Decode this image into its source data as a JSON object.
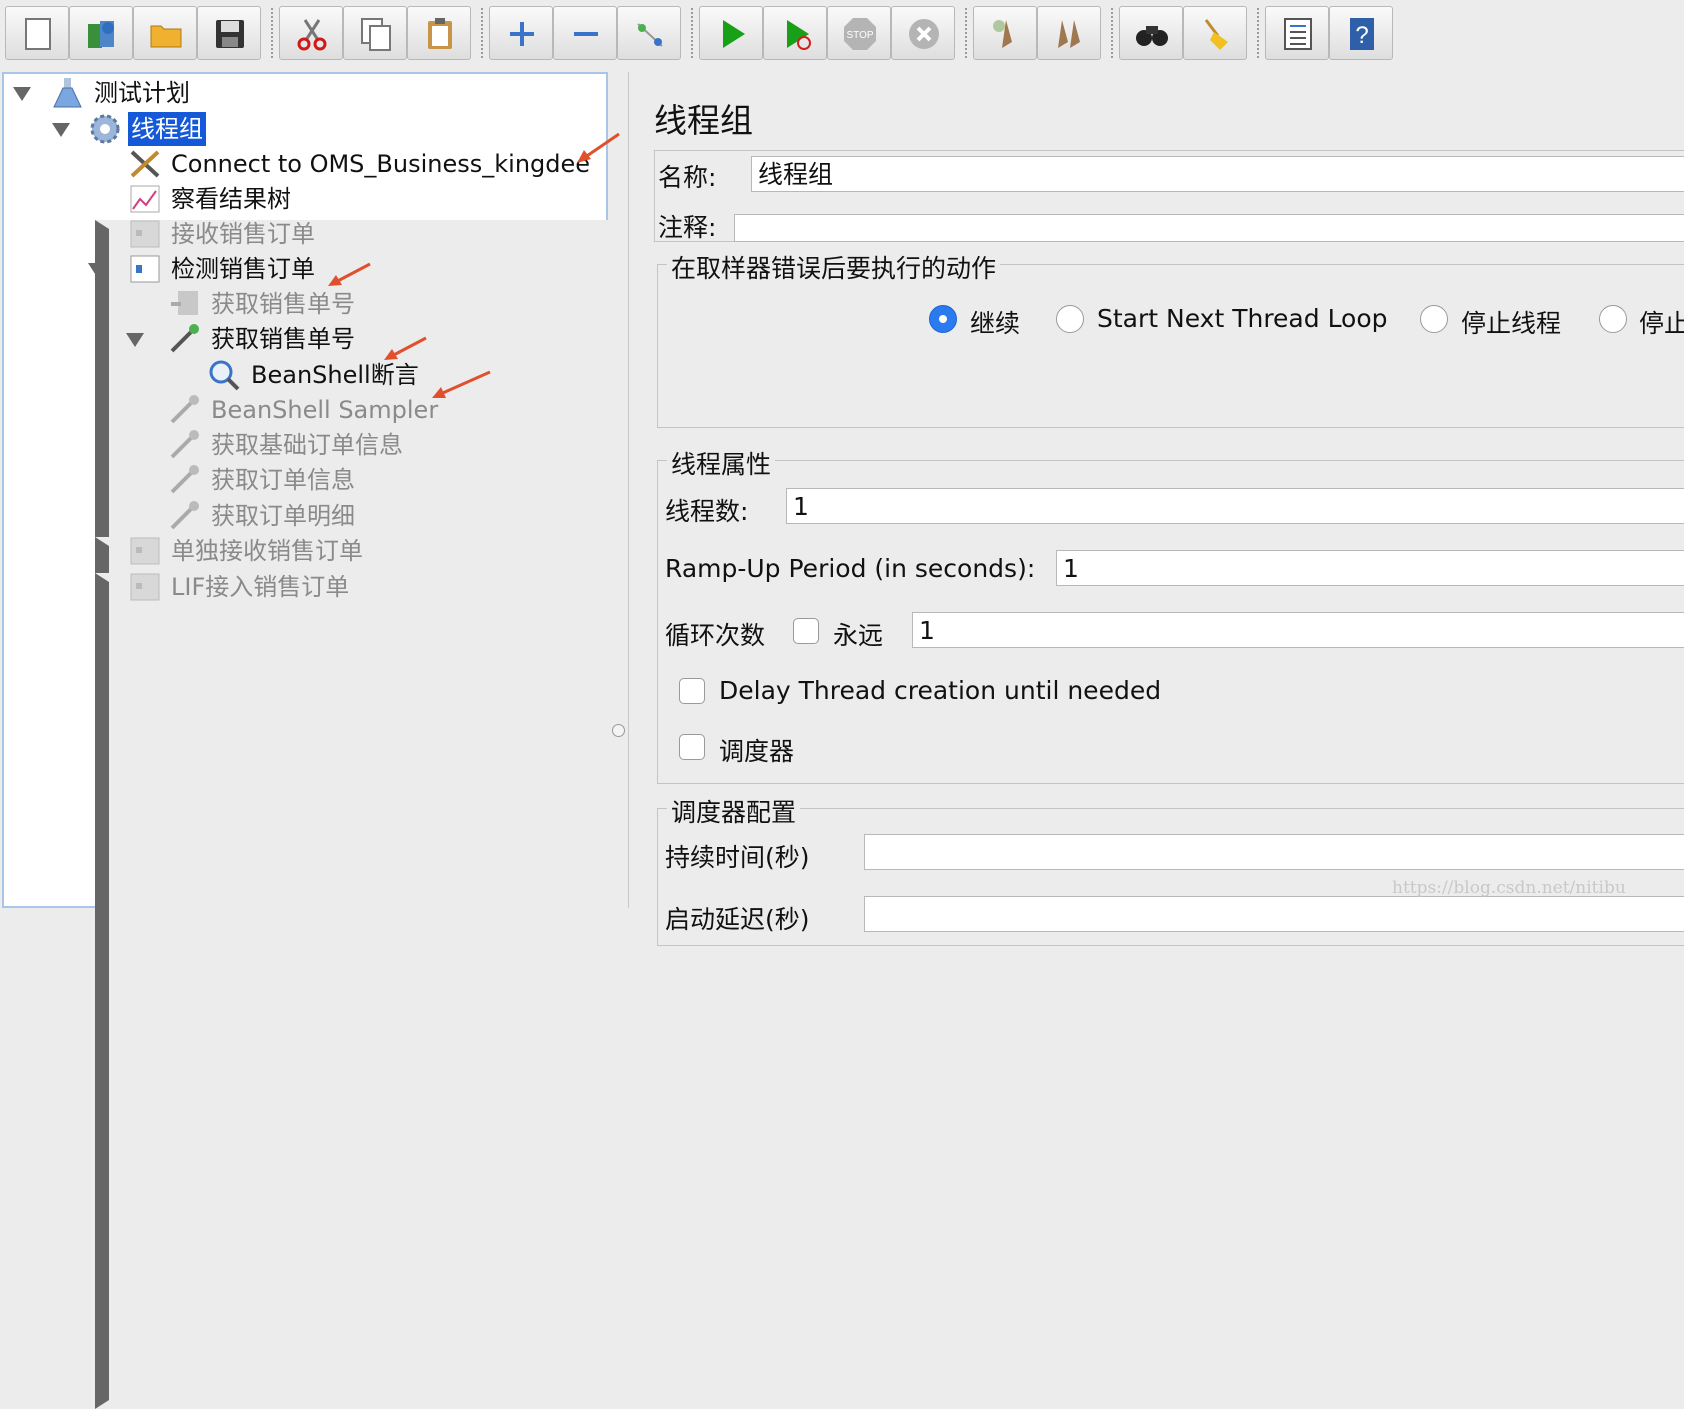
{
  "toolbar": {
    "buttons": [
      {
        "icon": "new-document-icon"
      },
      {
        "icon": "templates-icon"
      },
      {
        "icon": "open-folder-icon"
      },
      {
        "icon": "save-icon"
      },
      {
        "icon": "cut-icon"
      },
      {
        "icon": "copy-icon"
      },
      {
        "icon": "paste-icon"
      },
      {
        "icon": "expand-plus-icon"
      },
      {
        "icon": "collapse-minus-icon"
      },
      {
        "icon": "toggle-icon"
      },
      {
        "icon": "start-icon"
      },
      {
        "icon": "start-no-pauses-icon"
      },
      {
        "icon": "stop-icon",
        "text": "STOP"
      },
      {
        "icon": "shutdown-icon"
      },
      {
        "icon": "clear-icon"
      },
      {
        "icon": "clear-all-icon"
      },
      {
        "icon": "search-binoculars-icon"
      },
      {
        "icon": "reset-broom-icon"
      },
      {
        "icon": "function-helper-icon"
      },
      {
        "icon": "help-icon",
        "text": "?"
      }
    ]
  },
  "tree": {
    "nodes": [
      {
        "label": "测试计划",
        "icon": "test-plan-flask-icon"
      },
      {
        "label": "线程组",
        "icon": "thread-group-gear-icon"
      },
      {
        "label": "Connect to OMS_Business_kingdee",
        "icon": "jdbc-config-tools-icon"
      },
      {
        "label": "察看结果树",
        "icon": "results-tree-graph-icon"
      },
      {
        "label": "接收销售订单",
        "icon": "controller-icon"
      },
      {
        "label": "检测销售订单",
        "icon": "controller-icon"
      },
      {
        "label": "获取销售单号",
        "icon": "sampler-icon"
      },
      {
        "label": "获取销售单号",
        "icon": "sampler-pipette-icon"
      },
      {
        "label": "BeanShell断言",
        "icon": "assertion-magnifier-icon"
      },
      {
        "label": "BeanShell Sampler",
        "icon": "sampler-pipette-icon"
      },
      {
        "label": "获取基础订单信息",
        "icon": "sampler-pipette-icon"
      },
      {
        "label": "获取订单信息",
        "icon": "sampler-pipette-icon"
      },
      {
        "label": "获取订单明细",
        "icon": "sampler-pipette-icon"
      },
      {
        "label": "单独接收销售订单",
        "icon": "controller-icon"
      },
      {
        "label": "LIF接入销售订单",
        "icon": "controller-icon"
      }
    ]
  },
  "panel": {
    "title": "线程组",
    "name_label": "名称:",
    "name_value": "线程组",
    "comment_label": "注释:",
    "comment_value": "",
    "error_action": {
      "legend": "在取样器错误后要执行的动作",
      "options": [
        "继续",
        "Start Next Thread Loop",
        "停止线程",
        "停止"
      ],
      "selected": "继续"
    },
    "thread_props": {
      "legend": "线程属性",
      "threads_label": "线程数:",
      "threads_value": "1",
      "rampup_label": "Ramp-Up Period (in seconds):",
      "rampup_value": "1",
      "loop_label": "循环次数",
      "forever_label": "永远",
      "loop_value": "1",
      "delay_label": "Delay Thread creation until needed",
      "scheduler_label": "调度器"
    },
    "scheduler_config": {
      "legend": "调度器配置",
      "duration_label": "持续时间(秒)",
      "duration_value": "",
      "startup_delay_label": "启动延迟(秒)",
      "startup_delay_value": ""
    }
  },
  "watermark": "https://blog.csdn.net/nitibu",
  "colors": {
    "selection": "#1559d8",
    "arrow": "#e0502c",
    "radio": "#2a7af0"
  }
}
